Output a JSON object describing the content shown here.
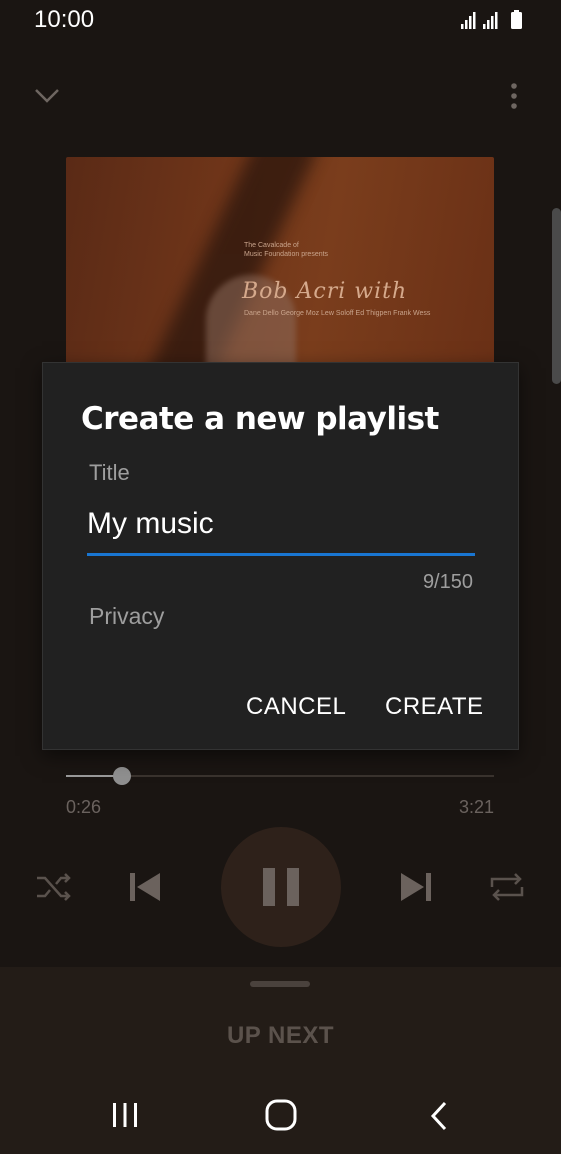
{
  "status_bar": {
    "time": "10:00"
  },
  "album": {
    "presenter_line1": "The Cavalcade of",
    "presenter_line2": "Music Foundation presents",
    "artist": "Bob Acri with",
    "credits": "Dane Dello George Moz Lew Soloff  Ed Thigpen Frank Wess"
  },
  "dialog": {
    "title": "Create a new playlist",
    "title_field_label": "Title",
    "title_field_value": "My music",
    "char_counter": "9/150",
    "privacy_label": "Privacy",
    "cancel_label": "CANCEL",
    "create_label": "CREATE",
    "accent_color": "#1976d2"
  },
  "player": {
    "current_time": "0:26",
    "duration": "3:21",
    "progress": 0.13
  },
  "up_next": {
    "label": "UP NEXT"
  }
}
